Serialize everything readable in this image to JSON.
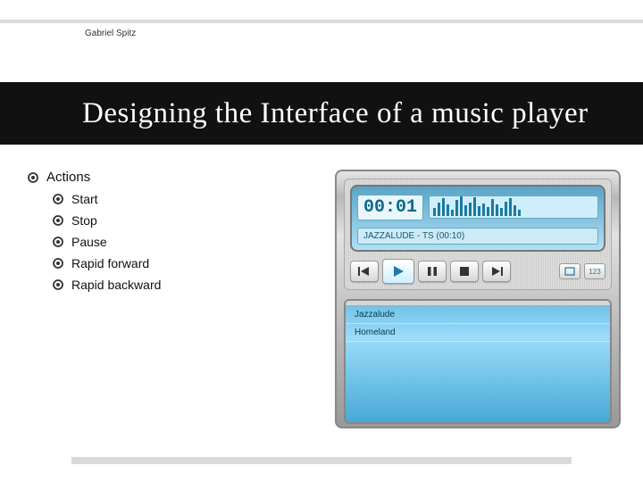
{
  "author": "Gabriel Spitz",
  "title": "Designing the Interface  of a music player",
  "bullets": {
    "heading": "Actions",
    "items": [
      "Start",
      "Stop",
      "Pause",
      "Rapid forward",
      "Rapid backward"
    ]
  },
  "player": {
    "time": "00:01",
    "now_playing": "JAZZALUDE - TS (00:10)",
    "aux_btn": "123",
    "playlist": [
      "Jazzalude",
      "Homeland"
    ],
    "spectrum_heights": [
      40,
      70,
      90,
      60,
      30,
      80,
      100,
      55,
      70,
      95,
      50,
      65,
      45,
      85,
      60,
      40,
      75,
      90,
      55,
      30
    ]
  }
}
